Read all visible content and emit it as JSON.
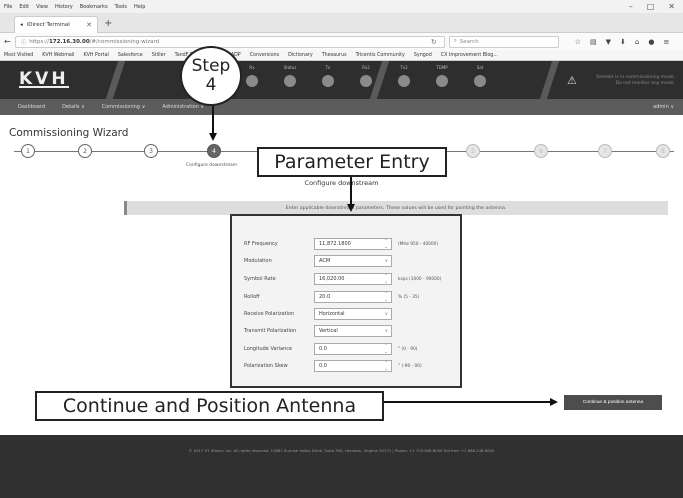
{
  "browser": {
    "menu": [
      "File",
      "Edit",
      "View",
      "History",
      "Bookmarks",
      "Tools",
      "Help"
    ],
    "tab_title": "iDirect Terminal",
    "url_prefix": "https://",
    "url_host": "172.16.30.00",
    "url_path": "/#/commissioning-wizard",
    "search_placeholder": "Search",
    "bookmarks": [
      "Most Visited",
      "KVH Webmail",
      "KVH Portal",
      "Salesforce",
      "Stiller",
      "TandF Portal",
      "ETC",
      "ADP",
      "Conversions",
      "Dictionary",
      "Thesaurus",
      "Tricentis Community",
      "Syngod",
      "CX Improvement Blog..."
    ]
  },
  "app": {
    "logo": "KVH",
    "status_labels": [
      "Rx",
      "Status",
      "Tx",
      "Rx2",
      "Tx2",
      "TDMP",
      "Sat"
    ],
    "warning_text": "Remote is in commissioning mode. Do not monitor any mode.",
    "nav": [
      "Dashboard",
      "Details ∨",
      "Commissioning ∨",
      "Administration ∨"
    ],
    "admin_label": "admin ∨"
  },
  "wizard": {
    "title": "Commissioning Wizard",
    "steps": [
      "1",
      "2",
      "3",
      "4",
      "5",
      "6",
      "7",
      "8"
    ],
    "active_step_label": "Configure downstream",
    "heading": "Configure downstream",
    "info": "Enter applicable downstream parameters. These values will be used for pointing the antenna.",
    "fields": [
      {
        "label": "RF Frequency",
        "value": "11,872.1800",
        "hint": "(MHz 950 - 40000)",
        "control": "stepper"
      },
      {
        "label": "Modulation",
        "value": "ACM",
        "hint": "",
        "control": "select"
      },
      {
        "label": "Symbol Rate",
        "value": "16,020.00",
        "hint": "ksps (1000 - 90000)",
        "control": "stepper"
      },
      {
        "label": "Rolloff",
        "value": "20.0",
        "hint": "% (5 - 35)",
        "control": "stepper"
      },
      {
        "label": "Receive Polarization",
        "value": "Horizontal",
        "hint": "",
        "control": "select"
      },
      {
        "label": "Transmit Polarization",
        "value": "Vertical",
        "hint": "",
        "control": "select"
      },
      {
        "label": "Longitude Variance",
        "value": "0.0",
        "hint": "° (0 - 90)",
        "control": "stepper"
      },
      {
        "label": "Polarization Skew",
        "value": "0.0",
        "hint": "° (-90 - 90)",
        "control": "stepper"
      }
    ],
    "continue_label": "Continue & position antenna"
  },
  "footer": "© 2017 VT iDirect, Inc. All rights reserved. 13861 Sunrise Valley Drive, Suite 300, Herndon, Virginia 20171 | Phone: +1 703.648.8000 Toll free: +1 888.248.8000",
  "callouts": {
    "step_word": "Step",
    "step_number": "4",
    "parameter_entry": "Parameter Entry",
    "continue": "Continue and Position Antenna"
  }
}
